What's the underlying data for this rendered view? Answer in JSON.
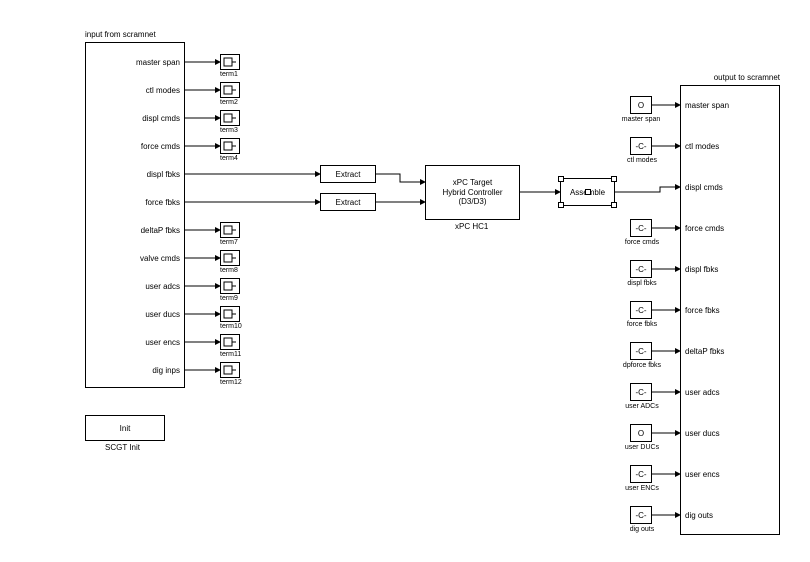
{
  "input_subsys": {
    "title": "input from scramnet",
    "ports": [
      {
        "label": "master span",
        "term": "term1"
      },
      {
        "label": "ctl modes",
        "term": "term2"
      },
      {
        "label": "displ cmds",
        "term": "term3"
      },
      {
        "label": "force cmds",
        "term": "term4"
      },
      {
        "label": "displ fbks",
        "term": null
      },
      {
        "label": "force fbks",
        "term": null
      },
      {
        "label": "deltaP fbks",
        "term": "term7"
      },
      {
        "label": "valve cmds",
        "term": "term8"
      },
      {
        "label": "user adcs",
        "term": "term9"
      },
      {
        "label": "user ducs",
        "term": "term10"
      },
      {
        "label": "user encs",
        "term": "term11"
      },
      {
        "label": "dig inps",
        "term": "term12"
      }
    ]
  },
  "extract1": {
    "label": "Extract"
  },
  "extract2": {
    "label": "Extract"
  },
  "xpc": {
    "line1": "xPC Target",
    "line2": "Hybrid Controller",
    "line3": "(D3/D3)",
    "below": "xPC HC1"
  },
  "assemble": {
    "label": "Assemble"
  },
  "scgt": {
    "label": "Init",
    "below": "SCGT Init"
  },
  "output_subsys": {
    "title": "output to scramnet",
    "ports": [
      {
        "label": "master span",
        "src": "O",
        "src_label": "master span"
      },
      {
        "label": "ctl modes",
        "src": "-C-",
        "src_label": "ctl modes"
      },
      {
        "label": "displ cmds",
        "src": null,
        "src_label": null
      },
      {
        "label": "force cmds",
        "src": "-C-",
        "src_label": "force cmds"
      },
      {
        "label": "displ fbks",
        "src": "-C-",
        "src_label": "displ fbks"
      },
      {
        "label": "force fbks",
        "src": "-C-",
        "src_label": "force fbks"
      },
      {
        "label": "deltaP fbks",
        "src": "-C-",
        "src_label": "dpforce fbks"
      },
      {
        "label": "user adcs",
        "src": "-C-",
        "src_label": "user ADCs"
      },
      {
        "label": "user ducs",
        "src": "O",
        "src_label": "user DUCs"
      },
      {
        "label": "user encs",
        "src": "-C-",
        "src_label": "user ENCs"
      },
      {
        "label": "dig outs",
        "src": "-C-",
        "src_label": "dig outs"
      }
    ]
  }
}
